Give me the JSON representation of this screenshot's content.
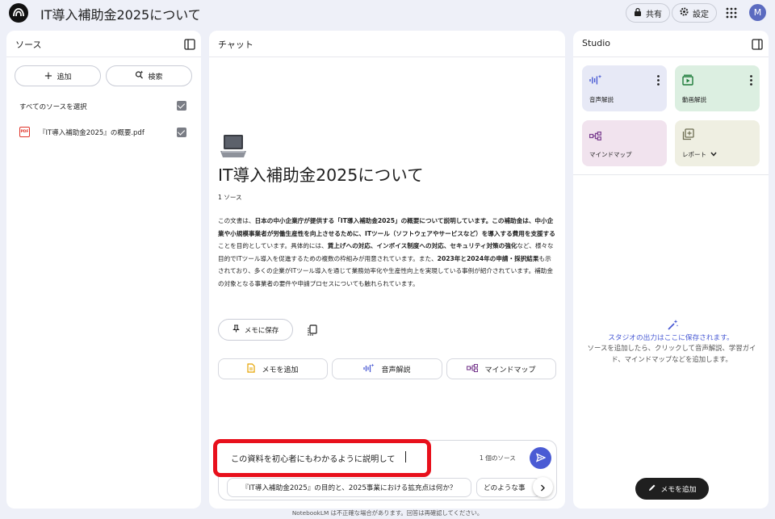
{
  "header": {
    "title": "IT導入補助金2025について",
    "share_label": "共有",
    "settings_label": "設定",
    "avatar_initial": "M"
  },
  "sources": {
    "panel_title": "ソース",
    "add_label": "追加",
    "search_label": "検索",
    "select_all_label": "すべてのソースを選択",
    "items": [
      {
        "name": "『IT導入補助金2025』の概要.pdf",
        "type_badge": "PDF",
        "checked": true
      }
    ]
  },
  "chat": {
    "panel_title": "チャット",
    "notebook_title": "IT導入補助金2025について",
    "source_count": "1 ソース",
    "summary": [
      {
        "t": "この文書は、",
        "b": false
      },
      {
        "t": "日本の中小企業庁が提供する「IT導入補助金2025」の概要について説明しています。この補助金は、中小企業や小規模事業者が労働生産性を向上させるために、ITツール（ソフトウェアやサービスなど）を導入する費用を支援する",
        "b": true
      },
      {
        "t": "ことを目的としています。具体的には、",
        "b": false
      },
      {
        "t": "賃上げへの対応、インボイス制度への対応、セキュリティ対策の強化",
        "b": true
      },
      {
        "t": "など、様々な目的でITツール導入を促進するための複数の枠組みが用意されています。また、",
        "b": false
      },
      {
        "t": "2023年と2024年の申請・採択結果",
        "b": true
      },
      {
        "t": "も示されており、多くの企業がITツール導入を通じて業務効率化や生産性向上を実現している事例が紹介されています。補助金の対象となる事業者の要件や申請プロセスについても触れられています。",
        "b": false
      }
    ],
    "save_note_label": "メモに保存",
    "actions": [
      "メモを追加",
      "音声解説",
      "マインドマップ"
    ],
    "input_value": "この資料を初心者にもわかるように説明して",
    "input_source_count": "1 個のソース",
    "suggestions": [
      "『IT導入補助金2025』の目的と、2025事業における拡充点は何か？",
      "どのような事"
    ]
  },
  "studio": {
    "panel_title": "Studio",
    "cards": [
      {
        "label": "音声解説",
        "icon": "audio-wave-icon",
        "bg": "#e7e9f6",
        "has_menu": true
      },
      {
        "label": "動画解説",
        "icon": "video-icon",
        "bg": "#dcefe1",
        "has_menu": true
      },
      {
        "label": "マインドマップ",
        "icon": "mindmap-icon",
        "bg": "#f1e3ee",
        "has_menu": false
      },
      {
        "label": "レポート",
        "icon": "report-icon",
        "bg": "#efefe2",
        "has_menu": false
      }
    ],
    "empty_title": "スタジオの出力はここに保存されます。",
    "empty_desc": "ソースを追加したら、クリックして音声解説、学習ガイド、マインドマップなどを追加します。",
    "add_note_label": "メモを追加"
  },
  "footer": {
    "disclaimer": "NotebookLM は不正確な場合があります。回答は再確認してください。"
  },
  "colors": {
    "accent": "#4a5bd4",
    "highlight_box": "#e8101c",
    "background": "#eef0f8"
  }
}
